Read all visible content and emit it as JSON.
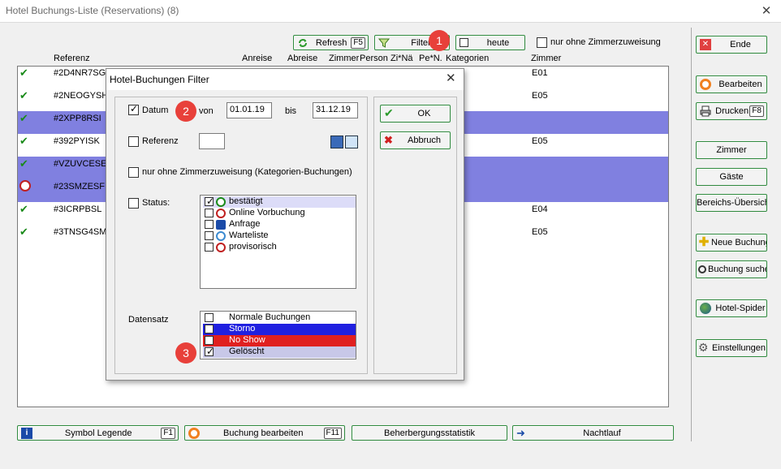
{
  "window": {
    "title": "Hotel Buchungs-Liste (Reservations) (8)"
  },
  "toolbar": {
    "refresh": "Refresh",
    "refresh_key": "F5",
    "filter": "Filter",
    "heute": "heute",
    "nur_ohne": "nur ohne Zimmerzuweisung"
  },
  "columns": {
    "referenz": "Referenz",
    "anreise": "Anreise",
    "abreise": "Abreise",
    "zimmer_short": "Zimmer",
    "person": "Person",
    "zina": "Zi*Nä",
    "pen": "Pe*N.",
    "kategorien": "Kategorien",
    "zimmer": "Zimmer"
  },
  "rows": [
    {
      "ref": "#2D4NR7SG",
      "zimmer": "E01",
      "status": "confirmed",
      "selected": false
    },
    {
      "ref": "#2NEOGYSH",
      "zimmer": "E05",
      "status": "confirmed",
      "selected": false
    },
    {
      "ref": "#2XPP8RSI",
      "zimmer": "",
      "status": "confirmed",
      "selected": true
    },
    {
      "ref": "#392PYISK",
      "zimmer": "E05",
      "status": "confirmed",
      "selected": false
    },
    {
      "ref": "#VZUVCESE",
      "zimmer": "",
      "status": "confirmed",
      "selected": true
    },
    {
      "ref": "#23SMZESF",
      "zimmer": "",
      "status": "online",
      "selected": true
    },
    {
      "ref": "#3ICRPBSL",
      "zimmer": "E04",
      "status": "confirmed",
      "selected": false
    },
    {
      "ref": "#3TNSG4SM",
      "zimmer": "E05",
      "status": "confirmed",
      "selected": false
    }
  ],
  "sidebar": {
    "ende": "Ende",
    "bearbeiten": "Bearbeiten",
    "drucken": "Drucken",
    "drucken_key": "F8",
    "zimmer": "Zimmer",
    "gaeste": "Gäste",
    "bereichs": "Bereichs-Übersich",
    "neue": "Neue Buchung",
    "suche": "Buchung suche",
    "spider": "Hotel-Spider",
    "einstellungen": "Einstellungen"
  },
  "bottom": {
    "legende": "Symbol Legende",
    "legende_key": "F1",
    "bearbeiten": "Buchung bearbeiten",
    "bearbeiten_key": "F11",
    "statistik": "Beherbergungsstatistik",
    "nachtlauf": "Nachtlauf"
  },
  "dialog": {
    "title": "Hotel-Buchungen Filter",
    "datum": "Datum",
    "von": "von",
    "von_value": "01.01.19",
    "bis": "bis",
    "bis_value": "31.12.19",
    "referenz": "Referenz",
    "referenz_value": "",
    "nur_ohne": "nur ohne Zimmerzuweisung (Kategorien-Buchungen)",
    "status": "Status:",
    "status_items": [
      "bestätigt",
      "Online Vorbuchung",
      "Anfrage",
      "Warteliste",
      "provisorisch"
    ],
    "datensatz": "Datensatz",
    "datensatz_items": [
      "Normale Buchungen",
      "Storno",
      "No Show",
      "Gelöscht"
    ],
    "ok": "OK",
    "abbruch": "Abbruch"
  },
  "badges": [
    "1",
    "2",
    "3"
  ],
  "colors": {
    "selected_row": "#8080e0",
    "storno": "#2020e0",
    "noshow": "#e02020",
    "badge": "#e8403a",
    "button_border": "#2f8a3e"
  }
}
